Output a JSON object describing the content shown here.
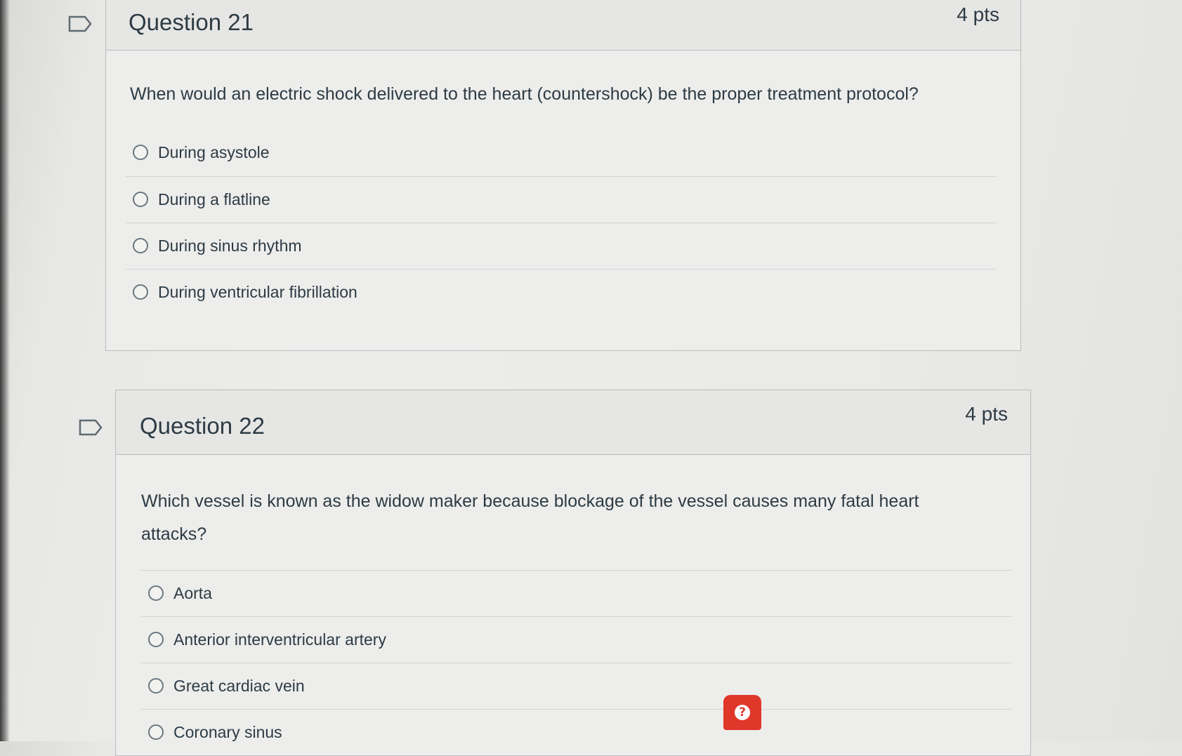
{
  "questions": [
    {
      "title": "Question 21",
      "points": "4 pts",
      "text": "When would an electric shock delivered to the heart (countershock) be the proper treatment protocol?",
      "answers": [
        "During asystole",
        "During a flatline",
        "During sinus rhythm",
        "During ventricular fibrillation"
      ]
    },
    {
      "title": "Question 22",
      "points": "4 pts",
      "text_line1": "Which vessel is known as the widow maker because blockage of the vessel causes many fatal heart",
      "text_line2": "attacks?",
      "answers": [
        "Aorta",
        "Anterior interventricular artery",
        "Great cardiac vein",
        "Coronary sinus"
      ]
    }
  ],
  "help_button": {
    "icon": "question-mark-icon",
    "label": "?"
  },
  "colors": {
    "help_button": "#e0372b",
    "text": "#2d3b45"
  }
}
